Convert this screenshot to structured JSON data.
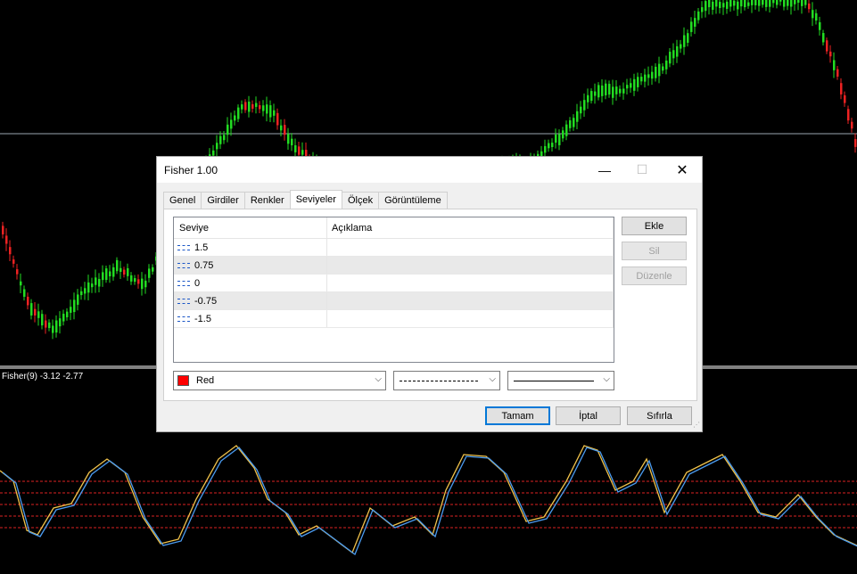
{
  "indicator_label": "Fisher(9) -3.12 -2.77",
  "dialog": {
    "title": "Fisher 1.00",
    "window_buttons": {
      "minimize": "—",
      "maximize": "☐",
      "close": "✕"
    },
    "tabs": [
      {
        "label": "Genel"
      },
      {
        "label": "Girdiler"
      },
      {
        "label": "Renkler"
      },
      {
        "label": "Seviyeler",
        "active": true
      },
      {
        "label": "Ölçek"
      },
      {
        "label": "Görüntüleme"
      }
    ],
    "levels_table": {
      "headers": {
        "level": "Seviye",
        "description": "Açıklama"
      },
      "rows": [
        {
          "level": "1.5",
          "description": ""
        },
        {
          "level": "0.75",
          "description": ""
        },
        {
          "level": "0",
          "description": ""
        },
        {
          "level": "-0.75",
          "description": ""
        },
        {
          "level": "-1.5",
          "description": ""
        }
      ]
    },
    "side_buttons": {
      "add": "Ekle",
      "delete": "Sil",
      "edit": "Düzenle"
    },
    "color_select": {
      "value": "Red",
      "swatch_color": "#ff0000"
    },
    "footer": {
      "ok": "Tamam",
      "cancel": "İptal",
      "reset": "Sıfırla"
    }
  }
}
